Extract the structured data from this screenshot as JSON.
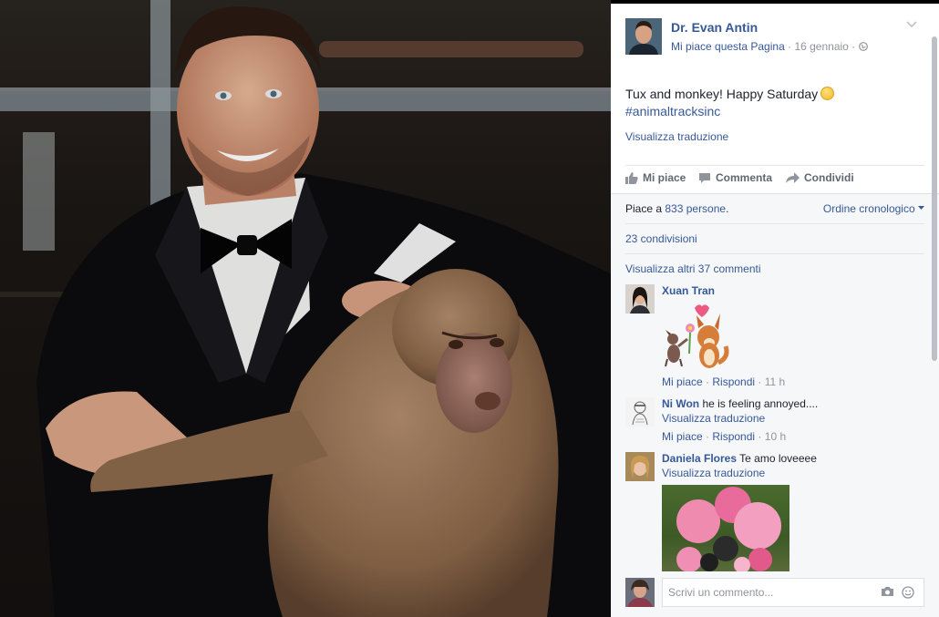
{
  "post": {
    "author": "Dr. Evan Antin",
    "like_page": "Mi piace questa Pagina",
    "date": "16 gennaio",
    "text": "Tux and monkey! Happy Saturday",
    "hashtag": "#animaltracksinc",
    "translate": "Visualizza traduzione"
  },
  "actions": {
    "like": "Mi piace",
    "comment": "Commenta",
    "share": "Condividi"
  },
  "stats": {
    "likes_prefix": "Piace a ",
    "likes_count": "833 persone",
    "likes_suffix": ".",
    "order": "Ordine cronologico",
    "shares": "23 condivisioni",
    "more_comments": "Visualizza altri 37 commenti"
  },
  "comments": [
    {
      "name": "Xuan Tran",
      "text": "",
      "like": "Mi piace",
      "reply": "Rispondi",
      "time": "11 h"
    },
    {
      "name": "Ni Won",
      "text": "he is feeling annoyed....",
      "translate": "Visualizza traduzione",
      "like": "Mi piace",
      "reply": "Rispondi",
      "time": "10 h"
    },
    {
      "name": "Daniela Flores",
      "text": "Te amo loveeee",
      "translate": "Visualizza traduzione"
    }
  ],
  "composer": {
    "placeholder": "Scrivi un commento..."
  },
  "separators": {
    "dot": "·"
  },
  "icons": {
    "menu": "chevron-down-icon",
    "globe": "globe-icon",
    "like": "thumbs-up-icon",
    "comment": "speech-bubble-icon",
    "share": "share-arrow-icon",
    "camera": "camera-icon",
    "emoji": "smiley-icon"
  },
  "colors": {
    "link": "#365899",
    "meta": "#90949c",
    "panel_bg": "#f6f7f9"
  }
}
